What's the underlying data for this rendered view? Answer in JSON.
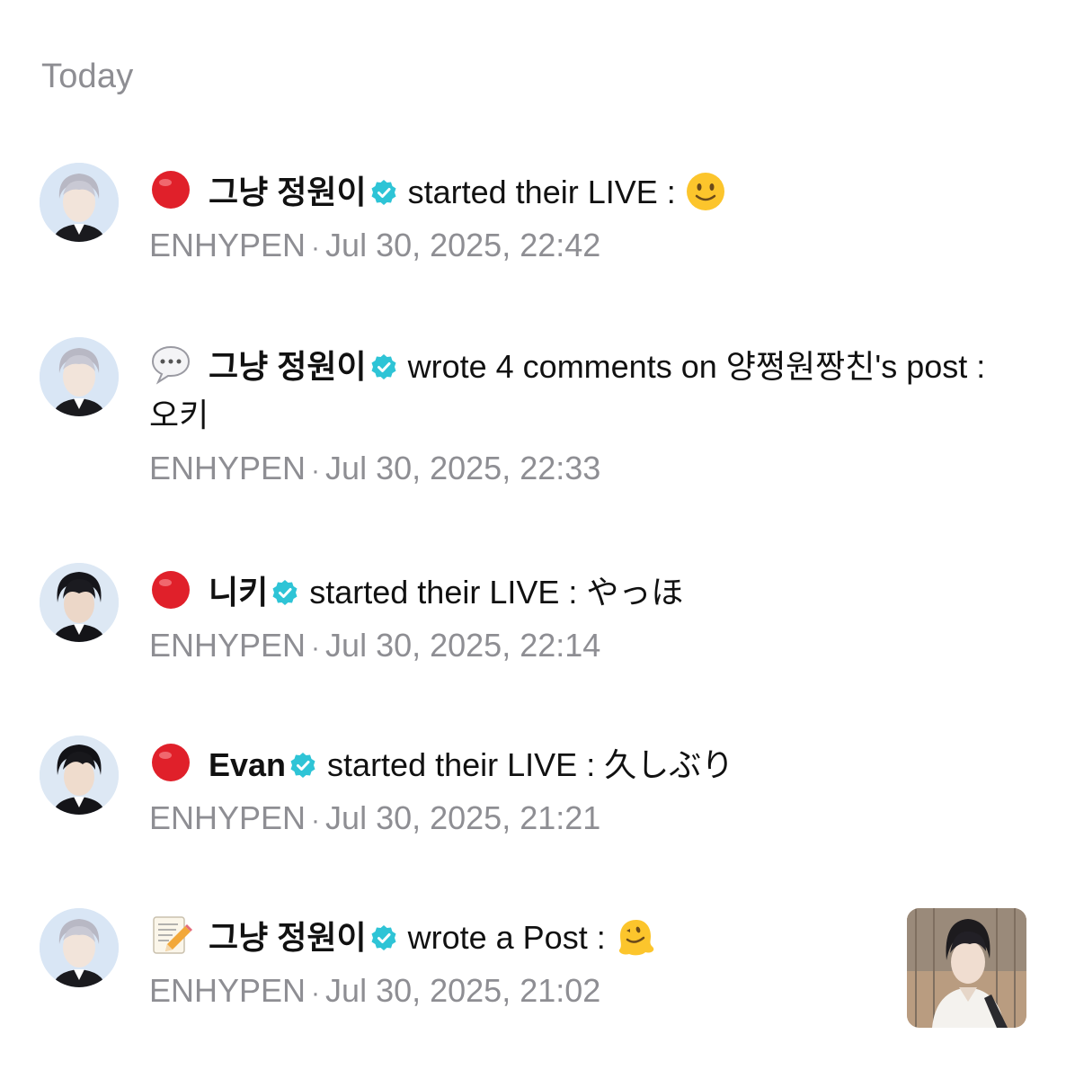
{
  "section": {
    "title": "Today"
  },
  "notifications": [
    {
      "author": "그냥 정원이",
      "action": "started their LIVE :",
      "type_icon": "red-circle-icon",
      "emoji": "slightly-smiling-face",
      "community": "ENHYPEN",
      "separator": "·",
      "time": "Jul 30, 2025, 22:42"
    },
    {
      "author": "그냥 정원이",
      "action": "wrote 4 comments on 양쩡원짱친's post : 오키",
      "type_icon": "speech-bubble-icon",
      "community": "ENHYPEN",
      "separator": "·",
      "time": "Jul 30, 2025, 22:33"
    },
    {
      "author": "니키",
      "action": "started their LIVE : やっほ",
      "type_icon": "red-circle-icon",
      "community": "ENHYPEN",
      "separator": "·",
      "time": "Jul 30, 2025, 22:14"
    },
    {
      "author": "Evan",
      "action": "started their LIVE : 久しぶり",
      "type_icon": "red-circle-icon",
      "community": "ENHYPEN",
      "separator": "·",
      "time": "Jul 30, 2025, 21:21"
    },
    {
      "author": "그냥 정원이",
      "action": "wrote a Post :",
      "type_icon": "memo-pencil-icon",
      "emoji": "melting-face",
      "community": "ENHYPEN",
      "separator": "·",
      "time": "Jul 30, 2025, 21:02",
      "has_thumbnail": true
    }
  ],
  "colors": {
    "verified": "#2ec4d6",
    "live_red": "#e0202a",
    "meta_gray": "#8e8e93"
  }
}
